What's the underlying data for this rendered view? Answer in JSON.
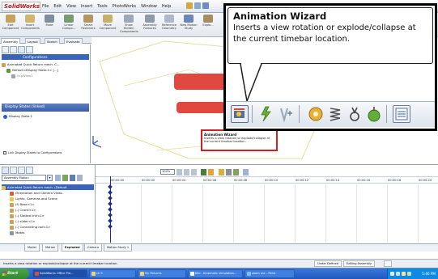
{
  "app": {
    "logo_text": "SolidWorks",
    "menu": [
      "File",
      "Edit",
      "View",
      "Insert",
      "Tools",
      "PhotoWorks",
      "Window",
      "Help"
    ]
  },
  "command_manager": {
    "buttons": [
      {
        "label": "Edit Component",
        "color": "#c9a25a"
      },
      {
        "label": "Insert Components",
        "color": "#d0b56a"
      },
      {
        "label": "Mate",
        "color": "#7f8e9e"
      },
      {
        "label": "Linear Compo...",
        "color": "#7a9b6e"
      },
      {
        "label": "Smart Fasteners",
        "color": "#b49760"
      },
      {
        "label": "Move Component",
        "color": "#c6b06c"
      },
      {
        "label": "Show Hidden Components",
        "color": "#a0a8b8"
      },
      {
        "label": "Assembly Features",
        "color": "#8f9aa9"
      },
      {
        "label": "Reference Geometry",
        "color": "#b0b8c6"
      },
      {
        "label": "New Motion Study",
        "color": "#6c86b8"
      },
      {
        "label": "Explo...",
        "color": "#a98c60"
      }
    ],
    "tabs": [
      "Assembly",
      "Layout",
      "Sketch",
      "Evaluate"
    ]
  },
  "feature_manager": {
    "config_label": "Configurations",
    "tree": [
      "Animated Quick Return mech. C...",
      "Default<Display State-1> [...]",
      "ExplView1"
    ],
    "display_states_header": "Display States (linked)",
    "display_state_item": "Display State-1",
    "link_checkbox_label": "Link Display States to Configurations"
  },
  "motion_study": {
    "study_type": "Assembly Motion",
    "zoom_value": "100%",
    "tree": [
      "Animated Quick Return mech. (Default",
      "Orientation and Camera Views",
      "Lights, Cameras and Scene",
      "(f) Base<1>",
      "(-) Crank<1>",
      "(-) Slotted link<1>",
      "(-) slider<1>",
      "(-) Connecting rod<1>",
      "Mates"
    ],
    "ticks": [
      "00:00:00",
      "00:00:02",
      "00:00:04",
      "00:00:06",
      "00:00:08",
      "00:00:10",
      "00:00:12",
      "00:00:14",
      "00:00:16",
      "00:00:18",
      "00:00:20"
    ],
    "bottom_tabs": [
      "Model",
      "Motion",
      "Exploded",
      "Camera",
      "Motion Study 1"
    ],
    "active_bottom_tab": "Exploded"
  },
  "tooltip_small": {
    "title": "Animation Wizard",
    "description": "Inserts a view rotation or explode/collapse at the current timebar location."
  },
  "tooltip_zoom": {
    "title": "Animation Wizard",
    "description": "Inserts a view rotation or explode/collapse at the current timebar location."
  },
  "status_bar": {
    "message": "Inserts a view rotation or explode/collapse at the current timebar location.",
    "state": "Under Defined",
    "mode": "Editing Assembly"
  },
  "taskbar": {
    "start": "Start",
    "tasks": [
      "SolidWorks Office Pre...",
      "ch 9",
      "My Pictures",
      "Kilo - Kinematic simulation...",
      "zoom out - Paint"
    ],
    "clock": "5:46 PM"
  },
  "colors": {
    "part_red": "#e1483f",
    "sketch_yellow": "#e8dc9c",
    "selection_blue": "#3a64b8",
    "tooltip_border": "#d31f1f"
  }
}
